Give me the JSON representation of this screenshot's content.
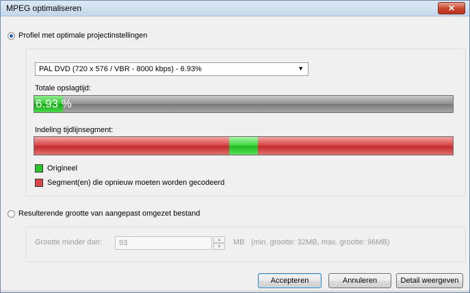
{
  "window": {
    "title": "MPEG optimaliseren",
    "close_label": "✕"
  },
  "profile_option": {
    "label": "Profiel met optimale projectinstellingen",
    "selected": true
  },
  "profile_select": {
    "value": "PAL DVD (720 x 576 / VBR - 8000 kbps) - 6.93%"
  },
  "storage": {
    "label": "Totale opslagtijd:",
    "percent_text": "6.93 %",
    "percent": 6.93
  },
  "timeline": {
    "label": "Indeling tijdlijnsegment:",
    "green_start": 0.465,
    "green_end": 0.535
  },
  "legend": {
    "original": {
      "label": "Origineel",
      "color": "#2cc42c"
    },
    "reencode": {
      "label": "Segment(en) die opnieuw moeten worden gecodeerd",
      "color": "#d94848"
    }
  },
  "size_option": {
    "label": "Resulterende grootte van aangepast omgezet bestand",
    "selected": false
  },
  "size_settings": {
    "label": "Grootte minder dan:",
    "value": "93",
    "unit": "MB",
    "info": "(min. grootte: 32MB, max. grootte: 96MB)"
  },
  "buttons": {
    "accept": "Accepteren",
    "cancel": "Annuleren",
    "details": "Detail weergeven"
  }
}
